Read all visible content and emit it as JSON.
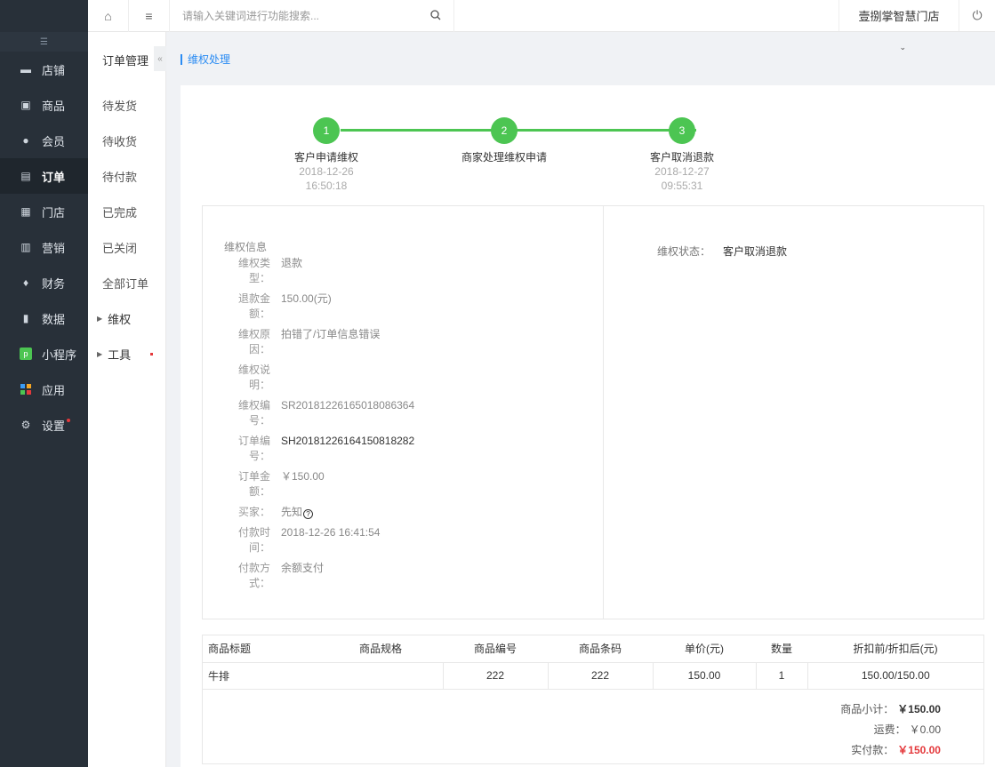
{
  "sidebar": {
    "collapse_icon": "menu-collapse-icon",
    "items": [
      {
        "label": "店铺",
        "icon": "store-icon"
      },
      {
        "label": "商品",
        "icon": "goods-icon"
      },
      {
        "label": "会员",
        "icon": "user-icon"
      },
      {
        "label": "订单",
        "icon": "order-icon",
        "active": true
      },
      {
        "label": "门店",
        "icon": "shop-icon"
      },
      {
        "label": "营销",
        "icon": "gift-icon"
      },
      {
        "label": "财务",
        "icon": "money-bag-icon"
      },
      {
        "label": "数据",
        "icon": "bar-chart-icon"
      },
      {
        "label": "小程序",
        "icon": "mini-program-icon"
      },
      {
        "label": "应用",
        "icon": "apps-icon"
      },
      {
        "label": "设置",
        "icon": "gear-icon",
        "badge": true
      }
    ]
  },
  "subnav": {
    "title": "订单管理",
    "items": [
      "待发货",
      "待收货",
      "待付款",
      "已完成",
      "已关闭",
      "全部订单"
    ],
    "groups": [
      "维权",
      "工具"
    ]
  },
  "topbar": {
    "search_placeholder": "请输入关键词进行功能搜索...",
    "store_name": "壹捌掌智慧门店"
  },
  "breadcrumb": "维权处理",
  "steps": [
    {
      "num": "1",
      "label": "客户申请维权",
      "date": "2018-12-26",
      "time": "16:50:18"
    },
    {
      "num": "2",
      "label": "商家处理维权申请",
      "date": "",
      "time": ""
    },
    {
      "num": "3",
      "label": "客户取消退款",
      "date": "2018-12-27",
      "time": "09:55:31"
    }
  ],
  "info": {
    "heading": "维权信息",
    "rows": [
      {
        "k1": "维权类",
        "k2": "型：",
        "v": "退款"
      },
      {
        "k1": "退款金",
        "k2": "额：",
        "v": "150.00(元)"
      },
      {
        "k1": "维权原",
        "k2": "因：",
        "v": "拍错了/订单信息错误"
      },
      {
        "k1": "维权说",
        "k2": "明：",
        "v": ""
      },
      {
        "k1": "维权编",
        "k2": "号：",
        "v": "SR20181226165018086364"
      },
      {
        "k1": "订单编",
        "k2": "号：",
        "v": "SH20181226164150818282"
      },
      {
        "k1": "订单金",
        "k2": "额：",
        "v": "￥150.00"
      },
      {
        "k1": "买家：",
        "k2": "",
        "v": "先知"
      },
      {
        "k1": "付款时",
        "k2": "间：",
        "v": "2018-12-26 16:41:54"
      },
      {
        "k1": "付款方",
        "k2": "式：",
        "v": "余额支付"
      }
    ],
    "status_label": "维权状态：",
    "status_value": "客户取消退款"
  },
  "table": {
    "headers": [
      "商品标题",
      "商品规格",
      "商品编号",
      "商品条码",
      "单价(元)",
      "数量",
      "折扣前/折扣后(元)"
    ],
    "rows": [
      [
        "牛排",
        "",
        "222",
        "222",
        "150.00",
        "1",
        "150.00/150.00"
      ]
    ]
  },
  "summary": {
    "subtotal_label": "商品小计：",
    "subtotal": "￥150.00",
    "shipping_label": "运费：",
    "shipping": "￥0.00",
    "paid_label": "实付款：",
    "paid": "￥150.00"
  }
}
